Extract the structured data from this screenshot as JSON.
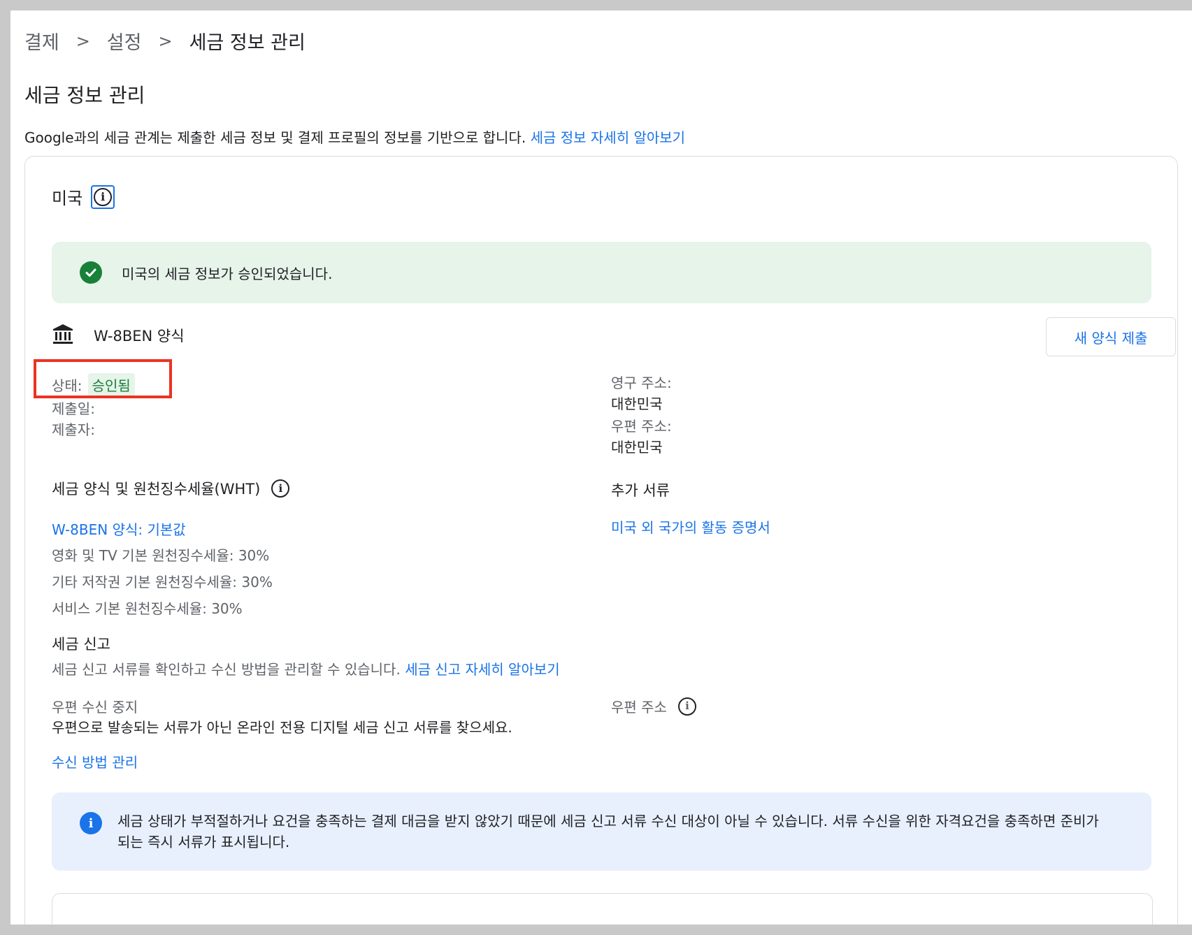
{
  "breadcrumb": {
    "items": [
      "결제",
      "설정",
      "세금 정보 관리"
    ],
    "separator": ">"
  },
  "page": {
    "title": "세금 정보 관리",
    "intro_text": "Google과의 세금 관계는 제출한 세금 정보 및 결제 프로필의 정보를 기반으로 합니다.",
    "intro_link": "세금 정보 자세히 알아보기"
  },
  "country": {
    "name": "미국",
    "info_icon": "info-icon"
  },
  "success_banner": {
    "text": "미국의 세금 정보가 승인되었습니다.",
    "icon": "check-circle-icon"
  },
  "form": {
    "icon": "bank-icon",
    "title": "W-8BEN 양식",
    "submit_button": "새 양식 제출",
    "status_label": "상태:",
    "status_value": "승인됨",
    "submitted_date_label": "제출일:",
    "submitted_by_label": "제출자:",
    "permanent_address_label": "영구 주소:",
    "permanent_address_value": "대한민국",
    "mailing_address_label": "우편 주소:",
    "mailing_address_value": "대한민국"
  },
  "wht": {
    "title": "세금 양식 및 원천징수세율(WHT)",
    "form_link": "W-8BEN 양식: 기본값",
    "rates": [
      "영화 및 TV 기본 원천징수세율: 30%",
      "기타 저작권 기본 원천징수세율: 30%",
      "서비스 기본 원천징수세율: 30%"
    ]
  },
  "additional_docs": {
    "title": "추가 서류",
    "link": "미국 외 국가의 활동 증명서"
  },
  "tax_reporting": {
    "title": "세금 신고",
    "description": "세금 신고 서류를 확인하고 수신 방법을 관리할 수 있습니다.",
    "learn_more_link": "세금 신고 자세히 알아보기",
    "mail_stop_label": "우편 수신 중지",
    "mail_stop_desc": "우편으로 발송되는 서류가 아닌 온라인 전용 디지털 세금 신고 서류를 찾으세요.",
    "manage_link": "수신 방법 관리",
    "mailing_address_label": "우편 주소"
  },
  "info_banner": {
    "text": "세금 상태가 부적절하거나 요건을 충족하는 결제 대금을 받지 않았기 때문에 세금 신고 서류 수신 대상이 아닐 수 있습니다. 서류 수신을 위한 자격요건을 충족하면 준비가 되는 즉시 서류가 표시됩니다."
  },
  "colors": {
    "link": "#1a73e8",
    "success_bg": "#e6f4ea",
    "success_icon": "#188038",
    "info_bg": "#e8f0fe",
    "highlight_border": "#ea3323"
  }
}
